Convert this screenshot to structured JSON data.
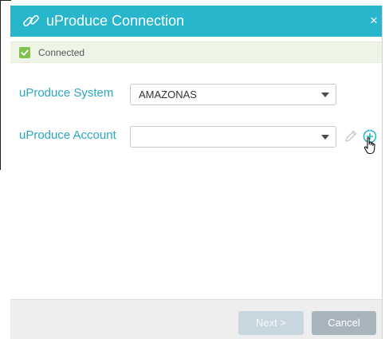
{
  "dialog": {
    "title": "uProduce Connection",
    "close_label": "×",
    "title_icon": "link-icon"
  },
  "status": {
    "text": "Connected",
    "icon": "check-icon",
    "color": "#82c14c"
  },
  "form": {
    "system_label": "uProduce System",
    "system_value": "AMAZONAS",
    "account_label": "uProduce Account",
    "account_value": "",
    "edit_icon": "pencil-icon",
    "add_icon": "plus-circle-icon"
  },
  "footer": {
    "next_label": "Next >",
    "cancel_label": "Cancel"
  },
  "colors": {
    "header": "#27b6cc",
    "label": "#2ba7c2",
    "banner": "#eef5e6"
  }
}
